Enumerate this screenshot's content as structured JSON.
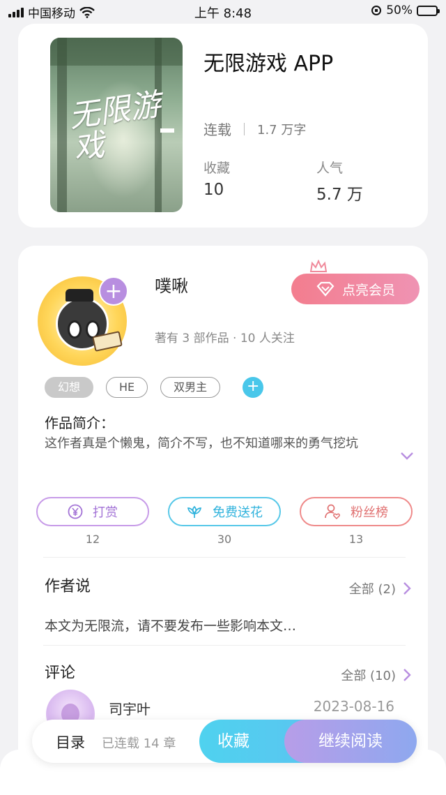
{
  "status_bar": {
    "carrier": "中国移动",
    "time": "上午 8:48",
    "battery": "50%",
    "battery_level": 0.5
  },
  "book": {
    "title": "无限游戏 APP",
    "status": "连载",
    "word_count": "1.7 万字",
    "stats": [
      {
        "label": "收藏",
        "value": "10"
      },
      {
        "label": "人气",
        "value": "5.7 万"
      }
    ],
    "cover_text": "无限游戏"
  },
  "author": {
    "name": "噗啾",
    "meta": "著有 3 部作品 · 10 人关注",
    "vip_button": "点亮会员"
  },
  "tags": [
    "幻想",
    "HE",
    "双男主"
  ],
  "intro": {
    "title": "作品简介：",
    "text": "这作者真是个懒鬼，简介不写，也不知道哪来的勇气挖坑"
  },
  "actions": [
    {
      "label": "打赏",
      "count": "12",
      "icon": "yen-coin-icon",
      "color": "#a373d6"
    },
    {
      "label": "免费送花",
      "count": "30",
      "icon": "flower-icon",
      "color": "#2fb2dc"
    },
    {
      "label": "粉丝榜",
      "count": "13",
      "icon": "user-heart-icon",
      "color": "#e07070"
    }
  ],
  "author_says": {
    "title": "作者说",
    "all": "全部 (2)",
    "text": "本文为无限流，请不要发布一些影响本文…"
  },
  "comments": {
    "title": "评论",
    "all": "全部 (10)",
    "items": [
      {
        "user": "司宇叶",
        "date": "2023-08-16"
      }
    ]
  },
  "bottom_bar": {
    "toc": "目录",
    "chapters": "已连载 14 章",
    "favorite": "收藏",
    "continue": "继续阅读"
  },
  "colors": {
    "accent_purple": "#b88ee0",
    "accent_cyan": "#4fd2ef",
    "vip_pink": "#f37d8e"
  }
}
